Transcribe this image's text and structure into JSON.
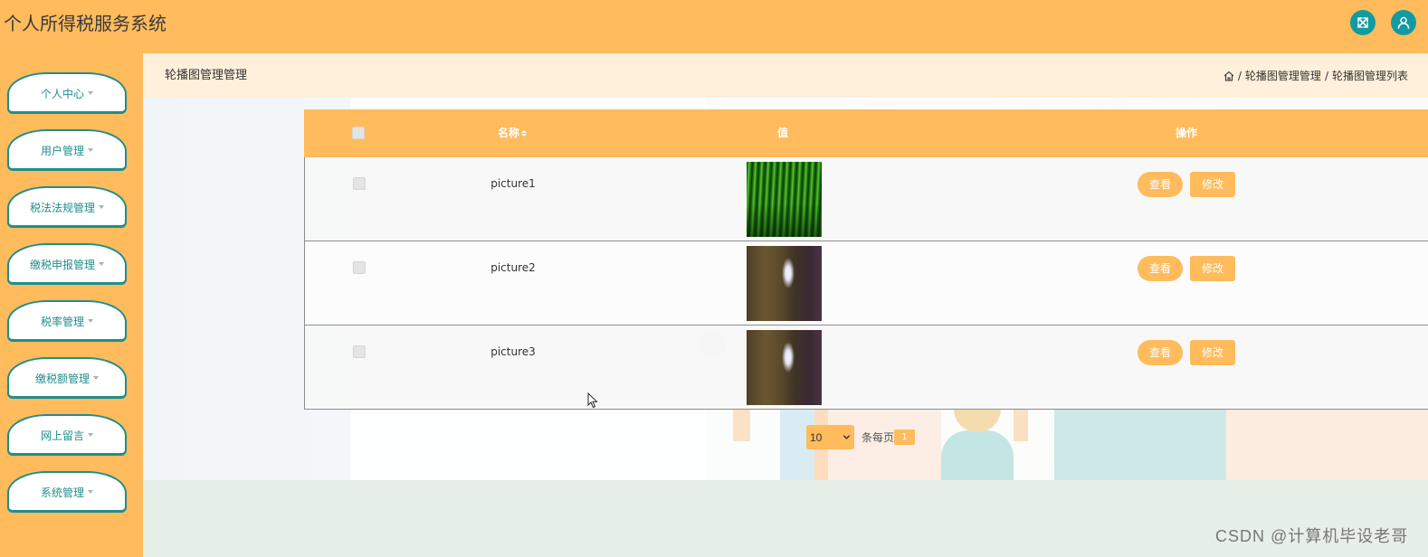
{
  "app": {
    "title": "个人所得税服务系统"
  },
  "header": {
    "icons": [
      "fullscreen-icon",
      "user-icon"
    ]
  },
  "sidebar": {
    "item_icon": "caret-down-icon",
    "items": [
      {
        "label": "个人中心"
      },
      {
        "label": "用户管理"
      },
      {
        "label": "税法法规管理"
      },
      {
        "label": "缴税申报管理"
      },
      {
        "label": "税率管理"
      },
      {
        "label": "缴税额管理"
      },
      {
        "label": "网上留言"
      },
      {
        "label": "系统管理"
      }
    ]
  },
  "breadcrumb": {
    "title": "轮播图管理管理",
    "home_icon": "home-icon",
    "separator": "/",
    "items": [
      "轮播图管理管理",
      "轮播图管理列表"
    ]
  },
  "table": {
    "columns": {
      "name": "名称",
      "value": "值",
      "actions": "操作"
    },
    "sort_icon": "sort-icon",
    "rows": [
      {
        "name": "picture1"
      },
      {
        "name": "picture2"
      },
      {
        "name": "picture3"
      }
    ],
    "actions": {
      "view": "查看",
      "edit": "修改"
    }
  },
  "pagination": {
    "page_size": "10",
    "per_page_label": "条每页",
    "current_page": "1"
  },
  "watermark": "CSDN @计算机毕设老哥",
  "colors": {
    "accent": "#FFBB5C",
    "teal": "#1F8E8C",
    "icon_bg": "#109BA3",
    "topbar": "#FFF0DB"
  }
}
